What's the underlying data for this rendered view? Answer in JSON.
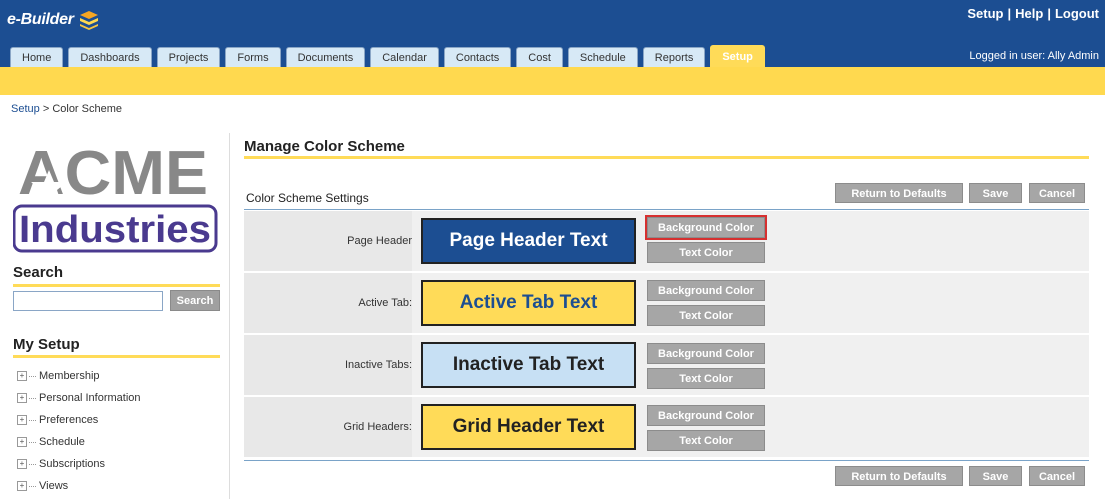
{
  "app": {
    "logo_text": "e-Builder"
  },
  "toplinks": {
    "setup": "Setup",
    "help": "Help",
    "logout": "Logout",
    "separator": "|"
  },
  "user": {
    "logged_in_text": "Logged in user: Ally Admin"
  },
  "tabs": [
    {
      "label": "Home"
    },
    {
      "label": "Dashboards"
    },
    {
      "label": "Projects"
    },
    {
      "label": "Forms"
    },
    {
      "label": "Documents"
    },
    {
      "label": "Calendar"
    },
    {
      "label": "Contacts"
    },
    {
      "label": "Cost"
    },
    {
      "label": "Schedule"
    },
    {
      "label": "Reports"
    },
    {
      "label": "Setup",
      "active": true
    }
  ],
  "breadcrumb": {
    "root": "Setup",
    "separator": ">",
    "current": "Color Scheme"
  },
  "company_logo": {
    "line1": "ACME",
    "line2": "Industries"
  },
  "search": {
    "title": "Search",
    "button_label": "Search",
    "placeholder": ""
  },
  "my_setup": {
    "title": "My Setup",
    "items": [
      {
        "label": "Membership"
      },
      {
        "label": "Personal Information"
      },
      {
        "label": "Preferences"
      },
      {
        "label": "Schedule"
      },
      {
        "label": "Subscriptions"
      },
      {
        "label": "Views"
      }
    ]
  },
  "main": {
    "title": "Manage Color Scheme",
    "settings_label": "Color Scheme Settings",
    "buttons": {
      "return_defaults": "Return to Defaults",
      "save": "Save",
      "cancel": "Cancel"
    },
    "rows": [
      {
        "label": "Page Header",
        "sample": "Page Header Text",
        "bg_button": "Background Color",
        "text_button": "Text Color"
      },
      {
        "label": "Active Tab:",
        "sample": "Active Tab Text",
        "bg_button": "Background Color",
        "text_button": "Text Color"
      },
      {
        "label": "Inactive Tabs:",
        "sample": "Inactive Tab Text",
        "bg_button": "Background Color",
        "text_button": "Text Color"
      },
      {
        "label": "Grid Headers:",
        "sample": "Grid Header Text",
        "bg_button": "Background Color",
        "text_button": "Text Color"
      }
    ]
  },
  "colors": {
    "header_bg": "#1c4e92",
    "accent_yellow": "#ffd94f",
    "page_header_sample_bg": "#1c4e92",
    "page_header_sample_text": "#ffffff",
    "active_tab_sample_bg": "#ffdb58",
    "active_tab_sample_text": "#1c4e92",
    "inactive_tab_sample_bg": "#c7e0f4",
    "inactive_tab_sample_text": "#222222",
    "grid_header_sample_bg": "#ffdb58",
    "grid_header_sample_text": "#222222"
  }
}
